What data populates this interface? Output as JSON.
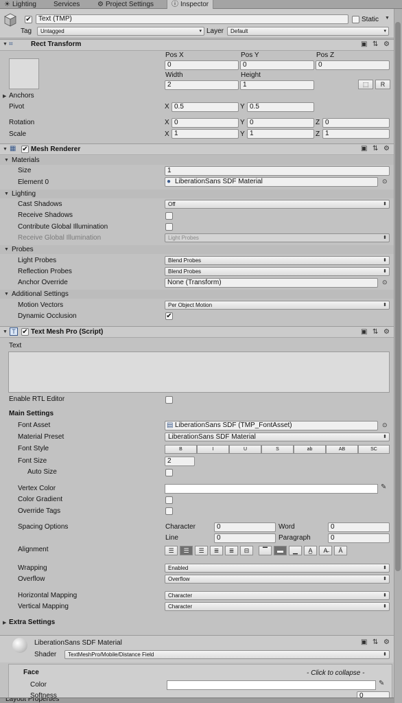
{
  "tabs": [
    {
      "label": "Lighting",
      "icon": "lighting-icon"
    },
    {
      "label": "Services",
      "icon": ""
    },
    {
      "label": "Project Settings",
      "icon": "gear-icon"
    },
    {
      "label": "Inspector",
      "icon": "info-icon"
    }
  ],
  "header": {
    "object_name": "Text (TMP)",
    "active": true,
    "static_label": "Static",
    "static_checked": false,
    "tag_label": "Tag",
    "tag_value": "Untagged",
    "layer_label": "Layer",
    "layer_value": "Default"
  },
  "rect_transform": {
    "title": "Rect Transform",
    "pos_x_label": "Pos X",
    "pos_y_label": "Pos Y",
    "pos_z_label": "Pos Z",
    "pos_x": "0",
    "pos_y": "0",
    "pos_z": "0",
    "width_label": "Width",
    "height_label": "Height",
    "width": "2",
    "height": "1",
    "r_button": "R",
    "anchors_label": "Anchors",
    "pivot_label": "Pivot",
    "pivot_x": "0.5",
    "pivot_y": "0.5",
    "rotation_label": "Rotation",
    "rot_x": "0",
    "rot_y": "0",
    "rot_z": "0",
    "scale_label": "Scale",
    "scale_x": "1",
    "scale_y": "1",
    "scale_z": "1",
    "x": "X",
    "y": "Y",
    "z": "Z"
  },
  "mesh_renderer": {
    "title": "Mesh Renderer",
    "enabled": true,
    "materials_label": "Materials",
    "size_label": "Size",
    "size": "1",
    "element0_label": "Element 0",
    "element0": "LiberationSans SDF Material",
    "lighting_label": "Lighting",
    "cast_shadows_label": "Cast Shadows",
    "cast_shadows": "Off",
    "receive_shadows_label": "Receive Shadows",
    "contribute_gi_label": "Contribute Global Illumination",
    "receive_gi_label": "Receive Global Illumination",
    "receive_gi": "Light Probes",
    "probes_label": "Probes",
    "light_probes_label": "Light Probes",
    "light_probes": "Blend Probes",
    "reflection_probes_label": "Reflection Probes",
    "reflection_probes": "Blend Probes",
    "anchor_override_label": "Anchor Override",
    "anchor_override": "None (Transform)",
    "additional_label": "Additional Settings",
    "motion_vectors_label": "Motion Vectors",
    "motion_vectors": "Per Object Motion",
    "dynamic_occlusion_label": "Dynamic Occlusion",
    "dynamic_occlusion": true
  },
  "tmp": {
    "title": "Text Mesh Pro (Script)",
    "enabled": true,
    "text_label": "Text",
    "text_value": "",
    "rtl_label": "Enable RTL Editor",
    "main_settings": "Main Settings",
    "font_asset_label": "Font Asset",
    "font_asset": "LiberationSans SDF (TMP_FontAsset)",
    "material_preset_label": "Material Preset",
    "material_preset": "LiberationSans SDF Material",
    "font_style_label": "Font Style",
    "font_styles": [
      "B",
      "I",
      "U",
      "S",
      "ab",
      "AB",
      "SC"
    ],
    "font_size_label": "Font Size",
    "font_size": "2",
    "auto_size_label": "Auto Size",
    "vertex_color_label": "Vertex Color",
    "vertex_color": "#ffffff",
    "color_gradient_label": "Color Gradient",
    "override_tags_label": "Override Tags",
    "spacing_label": "Spacing Options",
    "character_label": "Character",
    "character": "0",
    "word_label": "Word",
    "word": "0",
    "line_label": "Line",
    "line": "0",
    "paragraph_label": "Paragraph",
    "paragraph": "0",
    "alignment_label": "Alignment",
    "wrapping_label": "Wrapping",
    "wrapping": "Enabled",
    "overflow_label": "Overflow",
    "overflow": "Overflow",
    "hmapping_label": "Horizontal Mapping",
    "hmapping": "Character",
    "vmapping_label": "Vertical Mapping",
    "vmapping": "Character",
    "extra_settings": "Extra Settings"
  },
  "material": {
    "name": "LiberationSans SDF Material",
    "shader_label": "Shader",
    "shader": "TextMeshPro/Mobile/Distance Field",
    "face_label": "Face",
    "collapse_hint": "- Click to collapse -",
    "color_label": "Color",
    "color": "#ffffff",
    "softness_label": "Softness",
    "softness": "0"
  },
  "bottom": {
    "label": "Layout Properties"
  }
}
